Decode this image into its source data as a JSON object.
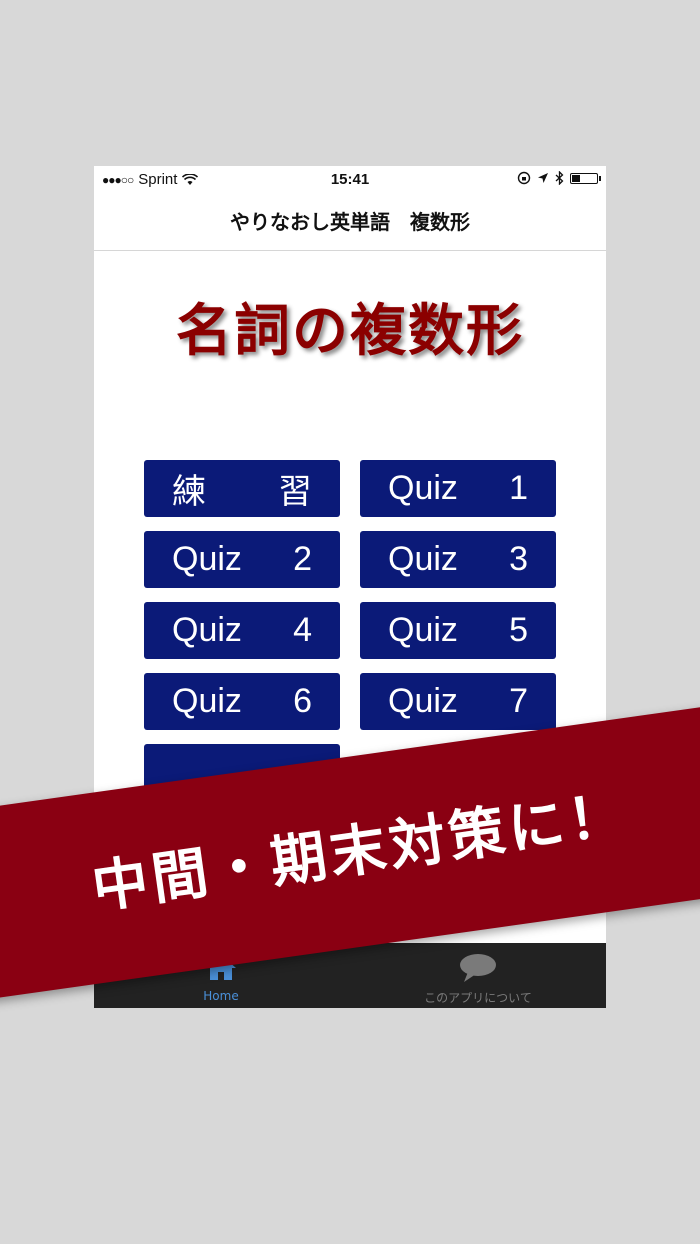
{
  "status_bar": {
    "signal_dots": "●●●○○",
    "carrier": "Sprint",
    "time": "15:41",
    "battery_level": 0.3
  },
  "nav": {
    "title": "やりなおし英単語　複数形"
  },
  "headline": "名詞の複数形",
  "buttons": [
    {
      "left": "練",
      "right": "習"
    },
    {
      "left": "Quiz",
      "right": "1"
    },
    {
      "left": "Quiz",
      "right": "2"
    },
    {
      "left": "Quiz",
      "right": "3"
    },
    {
      "left": "Quiz",
      "right": "4"
    },
    {
      "left": "Quiz",
      "right": "5"
    },
    {
      "left": "Quiz",
      "right": "6"
    },
    {
      "left": "Quiz",
      "right": "7"
    }
  ],
  "tabs": [
    {
      "label": "Home",
      "icon": "home-icon",
      "active": true
    },
    {
      "label": "このアプリについて",
      "icon": "speech-bubble-icon",
      "active": false
    }
  ],
  "banner": "中間・期末対策に！",
  "colors": {
    "background": "#d8d8d8",
    "button": "#0b1a78",
    "headline": "#8b0000",
    "banner": "#8a0012",
    "tab_active": "#4a90d9",
    "tab_inactive": "#7a7a7a",
    "tabbar": "#222222"
  }
}
